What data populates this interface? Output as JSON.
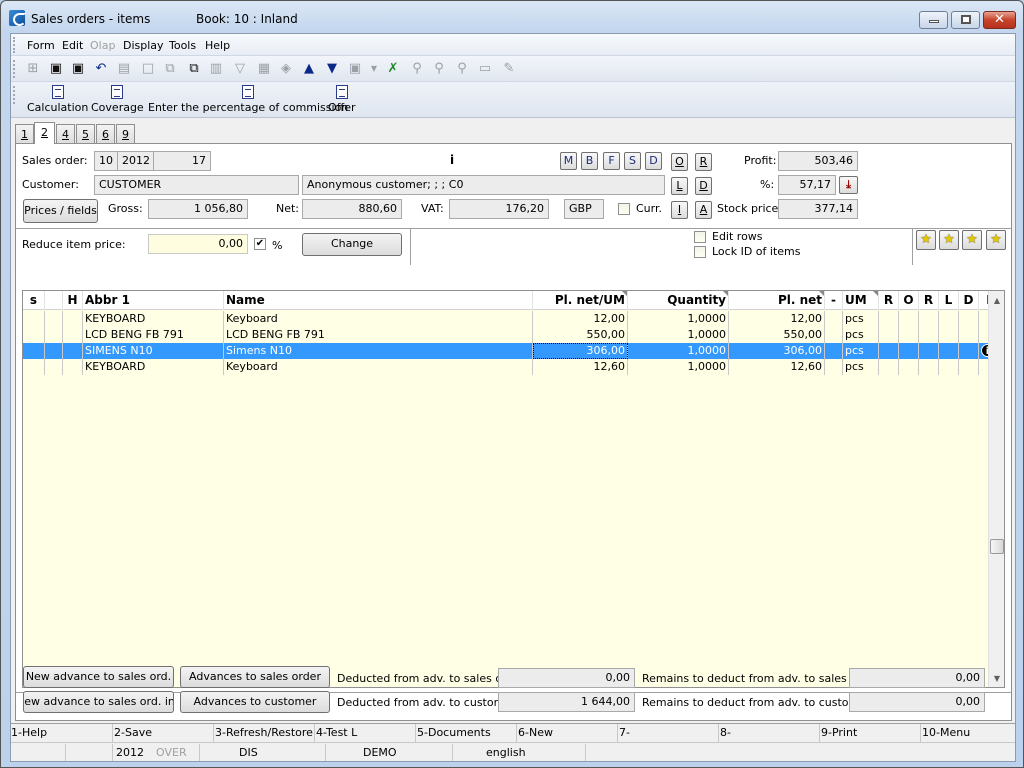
{
  "window": {
    "title": "Sales orders - items",
    "subtitle": "Book: 10 : Inland",
    "minimize_glyph": "—",
    "maximize_glyph": "▭",
    "close_glyph": "✕"
  },
  "menu": {
    "items": [
      "Form",
      "Edit",
      "Olap",
      "Display",
      "Tools",
      "Help"
    ]
  },
  "toolbar": {
    "icons": [
      "tree-icon",
      "save-icon",
      "save-as-icon",
      "undo-icon",
      "open-folder-icon",
      "new-document-icon",
      "copy-icon",
      "paste-icon",
      "book-icon",
      "filter-icon",
      "filter-list-icon",
      "print-preview-icon",
      "arrow-up-icon",
      "arrow-down-icon",
      "export-icon",
      "dropdown-icon",
      "excel-export-icon",
      "find-icon",
      "find-next-icon",
      "find-previous-icon",
      "image-icon",
      "edit-note-icon"
    ]
  },
  "toolbar2": {
    "buttons": [
      "Calculation",
      "Coverage",
      "Enter the percentage of commission",
      "Offer"
    ]
  },
  "tabs": [
    "1",
    "2",
    "4",
    "5",
    "6",
    "9"
  ],
  "active_tab": "2",
  "header": {
    "sales_order_label": "Sales order:",
    "sales_order_book": "10",
    "sales_order_year": "2012",
    "sales_order_number": "17",
    "info_marker": "i",
    "customer_label": "Customer:",
    "customer_code": "CUSTOMER",
    "customer_name": "Anonymous customer; ; ; C0",
    "prices_fields_button": "Prices / fields",
    "gross_label": "Gross:",
    "gross_value": "1 056,80",
    "net_label": "Net:",
    "net_value": "880,60",
    "vat_label": "VAT:",
    "vat_value": "176,20",
    "currency": "GBP",
    "curr_label": "Curr.",
    "curr_checked": false,
    "mbfsd_buttons": [
      "M",
      "B",
      "F",
      "S",
      "D"
    ],
    "side_buttons": [
      "O",
      "R",
      "L",
      "D",
      "I",
      "A"
    ],
    "profit_label": "Profit:",
    "profit_value": "503,46",
    "percent_label": "%:",
    "percent_value": "57,17",
    "stock_price_label": "Stock price:",
    "stock_price_value": "377,14"
  },
  "reduce": {
    "label": "Reduce item price:",
    "value": "0,00",
    "percent_checked": true,
    "percent_label": "%",
    "change_button": "Change",
    "check_mark": "✔"
  },
  "options": {
    "edit_rows_label": "Edit rows",
    "edit_rows_checked": false,
    "lock_id_label": "Lock ID of items",
    "lock_id_checked": false
  },
  "grid": {
    "columns": [
      "s",
      "",
      "H",
      "Abbr 1",
      "Name",
      "Pl. net/UM",
      "Quantity",
      "Pl. net",
      "-",
      "UM",
      "R",
      "O",
      "R",
      "L",
      "D",
      "I"
    ],
    "rows": [
      {
        "abbr": "KEYBOARD",
        "name": "Keyboard",
        "price_um": "12,00",
        "quantity": "1,0000",
        "price_net": "12,00",
        "um": "pcs",
        "info": ""
      },
      {
        "abbr": "LCD BENG FB 791",
        "name": "LCD BENG FB 791",
        "price_um": "550,00",
        "quantity": "1,0000",
        "price_net": "550,00",
        "um": "pcs",
        "info": ""
      },
      {
        "abbr": "SIMENS N10",
        "name": "Simens N10",
        "price_um": "306,00",
        "quantity": "1,0000",
        "price_net": "306,00",
        "um": "pcs",
        "info": "i"
      },
      {
        "abbr": "KEYBOARD",
        "name": "Keyboard",
        "price_um": "12,60",
        "quantity": "1,0000",
        "price_net": "12,60",
        "um": "pcs",
        "info": ""
      }
    ],
    "selected_row": 2,
    "scroll_up": "▲",
    "scroll_down": "▼"
  },
  "advances": {
    "new_advance_button": "New advance to sales ord.",
    "new_advance_percent_button": "New advance to sales ord. in %",
    "advances_to_order_button": "Advances to sales order",
    "advances_to_customer_button": "Advances to customer",
    "deducted_order_label": "Deducted from adv. to sales ord.:",
    "deducted_order_value": "0,00",
    "deducted_customer_label": "Deducted from adv. to customer:",
    "deducted_customer_value": "1 644,00",
    "remains_order_label": "Remains to deduct from adv. to sales order:",
    "remains_order_value": "0,00",
    "remains_customer_label": "Remains to deduct from adv. to customer:",
    "remains_customer_value": "0,00"
  },
  "fkeys": [
    "1-Help",
    "2-Save",
    "3-Refresh/Restore",
    "4-Test L",
    "5-Documents",
    "6-New",
    "7-",
    "8-",
    "9-Print",
    "10-Menu"
  ],
  "status": {
    "year": "2012",
    "over": "OVER",
    "mode": "DIS",
    "database": "DEMO",
    "language": "english"
  }
}
